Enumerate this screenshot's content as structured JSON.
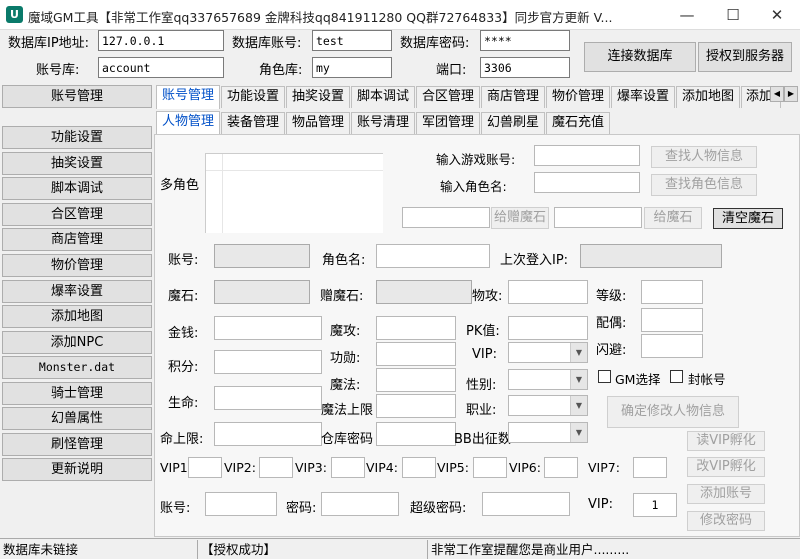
{
  "window": {
    "title": "魔域GM工具【非常工作室qq337657689 金牌科技qq841911280 QQ群72764833】同步官方更新 V...",
    "icon_glyph": "U"
  },
  "db": {
    "ip_label": "数据库IP地址:",
    "ip_value": "127.0.0.1",
    "account_label": "数据库账号:",
    "account_value": "test",
    "password_label": "数据库密码:",
    "password_value": "****",
    "acctdb_label": "账号库:",
    "acctdb_value": "account",
    "roledb_label": "角色库:",
    "roledb_value": "my",
    "port_label": "端口:",
    "port_value": "3306",
    "connect_button": "连接数据库",
    "authorize_button": "授权到服务器"
  },
  "sidebar": {
    "items": [
      {
        "label": "账号管理",
        "mono": false
      },
      {
        "label": "功能设置",
        "mono": false
      },
      {
        "label": "抽奖设置",
        "mono": false
      },
      {
        "label": "脚本调试",
        "mono": false
      },
      {
        "label": "合区管理",
        "mono": false
      },
      {
        "label": "商店管理",
        "mono": false
      },
      {
        "label": "物价管理",
        "mono": false
      },
      {
        "label": "爆率设置",
        "mono": false
      },
      {
        "label": "添加地图",
        "mono": false
      },
      {
        "label": "添加NPC",
        "mono": false
      },
      {
        "label": "Monster.dat",
        "mono": true
      },
      {
        "label": "骑士管理",
        "mono": false
      },
      {
        "label": "幻兽属性",
        "mono": false
      },
      {
        "label": "刷怪管理",
        "mono": false
      },
      {
        "label": "更新说明",
        "mono": false
      }
    ]
  },
  "tabs": [
    {
      "label": "账号管理",
      "active": true
    },
    {
      "label": "功能设置",
      "active": false
    },
    {
      "label": "抽奖设置",
      "active": false
    },
    {
      "label": "脚本调试",
      "active": false
    },
    {
      "label": "合区管理",
      "active": false
    },
    {
      "label": "商店管理",
      "active": false
    },
    {
      "label": "物价管理",
      "active": false
    },
    {
      "label": "爆率设置",
      "active": false
    },
    {
      "label": "添加地图",
      "active": false
    },
    {
      "label": "添加NPC",
      "active": false
    }
  ],
  "subtabs": [
    {
      "label": "人物管理",
      "active": true
    },
    {
      "label": "装备管理",
      "active": false
    },
    {
      "label": "物品管理",
      "active": false
    },
    {
      "label": "账号清理",
      "active": false
    },
    {
      "label": "军团管理",
      "active": false
    },
    {
      "label": "幻兽刷星",
      "active": false
    },
    {
      "label": "魔石充值",
      "active": false
    }
  ],
  "scroll_arrows": {
    "left": "◀",
    "right": "▶"
  },
  "roles": {
    "multi_role_label": "多角色",
    "input_account_label": "输入游戏账号:",
    "input_role_label": "输入角色名:",
    "find_person_button": "查找人物信息",
    "find_role_button": "查找角色信息",
    "give_gift_stone_button": "给赠魔石",
    "give_stone_button": "给魔石",
    "clear_stone_button": "清空魔石"
  },
  "fields": {
    "account": "账号:",
    "role_name": "角色名:",
    "last_ip": "上次登入IP:",
    "stone": "魔石:",
    "gift_stone": "赠魔石:",
    "phys_attack": "物攻:",
    "level": "等级:",
    "gold": "金钱:",
    "magic_attack": "魔攻:",
    "pk": "PK值:",
    "spouse": "配偶:",
    "points": "积分:",
    "merit": "功勋:",
    "vip": "VIP:",
    "dodge": "闪避:",
    "life": "生命:",
    "mana": "魔法:",
    "gender": "性别:",
    "gm_select": "GM选择",
    "ban_account": "封帐号",
    "max_mana": "魔法上限",
    "profession": "职业:",
    "confirm_button": "确定修改人物信息",
    "max_life": "命上限:",
    "warehouse_password": "仓库密码",
    "bb_count": "BB出征数",
    "read_vip_button": "读VIP孵化",
    "change_vip_button": "改VIP孵化"
  },
  "vip_row": {
    "labels": [
      "VIP1",
      "VIP2:",
      "VIP3:",
      "VIP4:",
      "VIP5:",
      "VIP6:",
      "VIP7:"
    ]
  },
  "bottom_row": {
    "account": "账号:",
    "password": "密码:",
    "super_password": "超级密码:",
    "vip": "VIP:",
    "vip_value": "1",
    "add_account_button": "添加账号",
    "change_password_button": "修改密码"
  },
  "status": {
    "db": "数据库未链接",
    "auth": "【授权成功】",
    "notice": "非常工作室提醒您是商业用户........."
  }
}
